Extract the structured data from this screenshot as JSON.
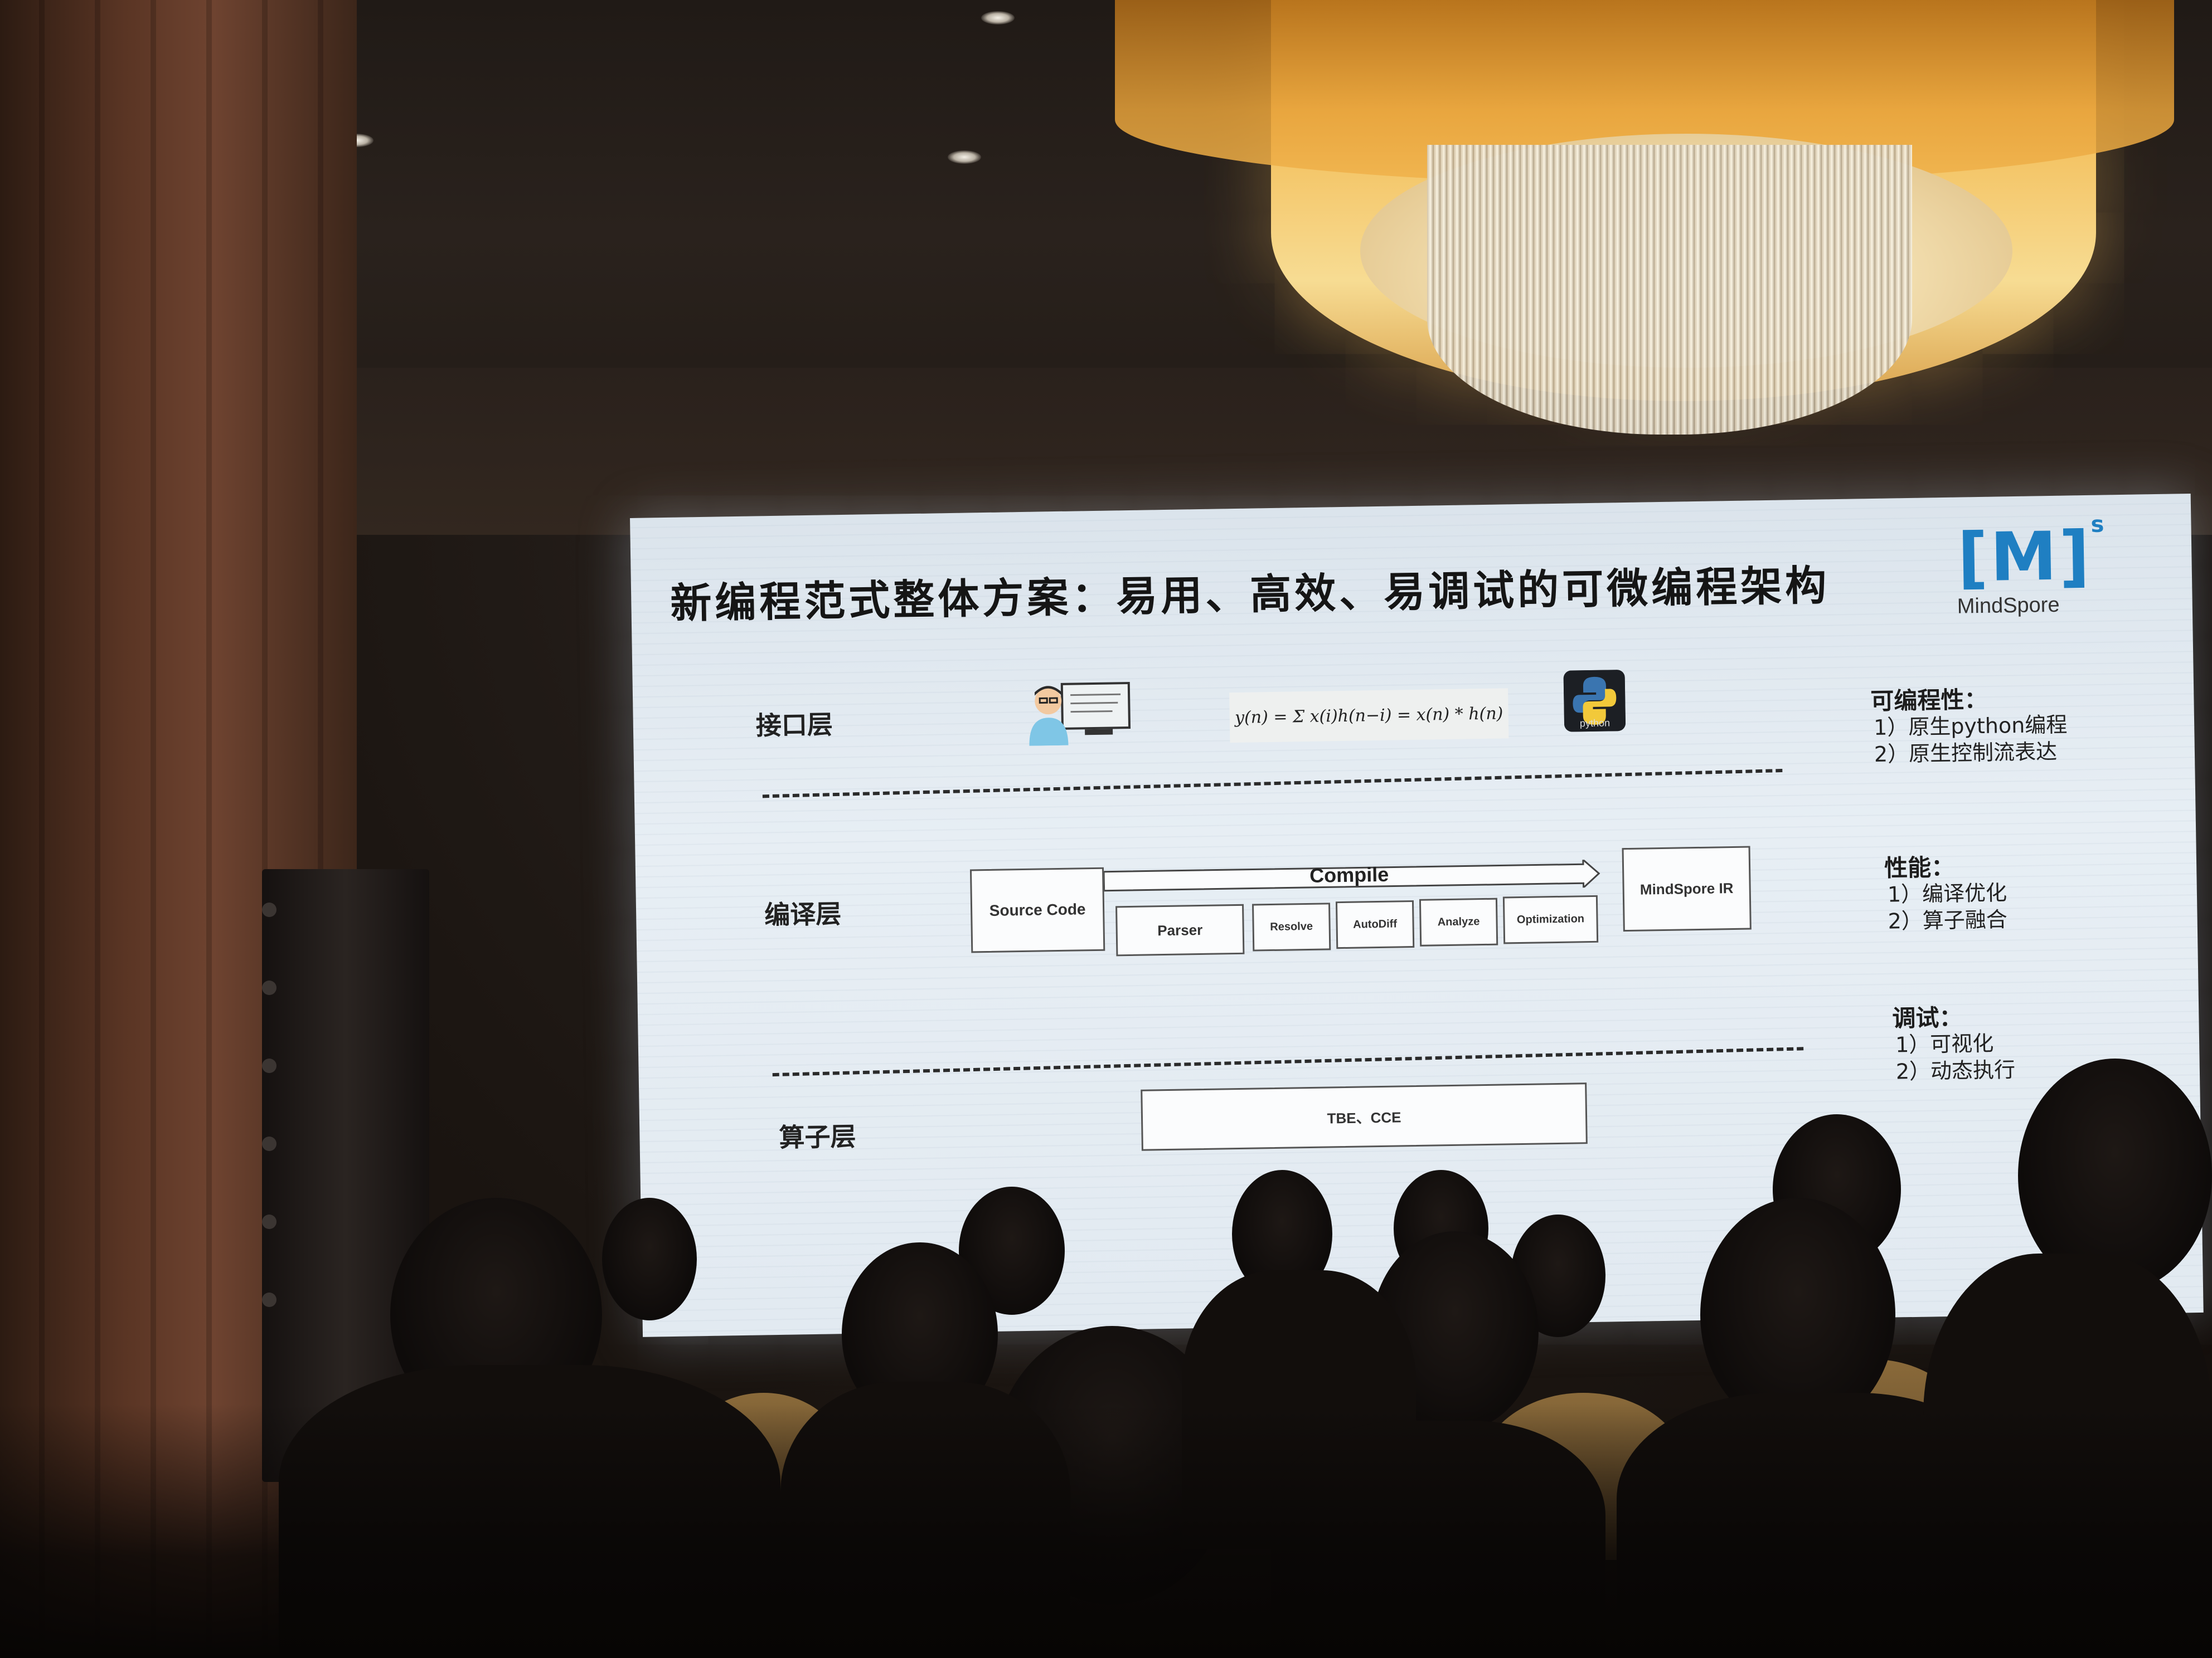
{
  "slide": {
    "title": "新编程范式整体方案：易用、高效、易调试的可微编程架构",
    "logo": {
      "mark": "[M]",
      "sup": "s",
      "name": "MindSpore"
    },
    "layers": {
      "interface": "接口层",
      "compile": "编译层",
      "operator": "算子层"
    },
    "formula": "y(n) = Σ x(i)h(n−i) = x(n) * h(n)",
    "python_label": "python",
    "compile_flow": {
      "source": "Source Code",
      "compile": "Compile",
      "steps": [
        "Parser",
        "Resolve",
        "AutoDiff",
        "Analyze",
        "Optimization"
      ],
      "target": "MindSpore IR"
    },
    "operator_box": "TBE、CCE",
    "side_notes": {
      "programmability": {
        "head": "可编程性：",
        "items": [
          "1）原生python编程",
          "2）原生控制流表达"
        ]
      },
      "performance": {
        "head": "性能：",
        "items": [
          "1）编译优化",
          "2）算子融合"
        ]
      },
      "debug": {
        "head": "调试：",
        "items": [
          "1）可视化",
          "2）动态执行"
        ]
      }
    }
  },
  "colors": {
    "screen": "#e2eaf1",
    "chandelier": "#f4c567",
    "logo": "#1f7fc2",
    "wall": "#5a3524"
  }
}
